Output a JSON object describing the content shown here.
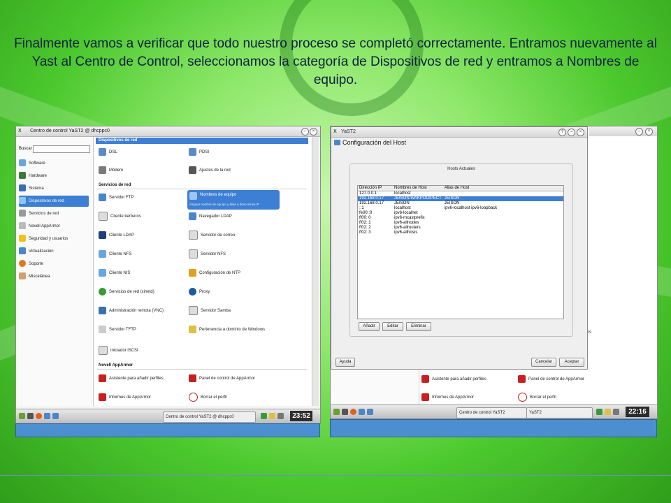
{
  "caption": "Finalmente vamos a verificar que todo nuestro proceso se completó correctamente. Entramos nuevamente al Yast al Centro de Control, seleccionamos la categoría de Dispositivos de red y entramos a Nombres de equipo.",
  "left": {
    "title": "Centro de control YaST2 @ dhcppc0",
    "search_label": "Buscar",
    "sidebar": [
      "Software",
      "Hardware",
      "Sistema",
      "Dispositivos de red",
      "Servicios de red",
      "Novell AppArmor",
      "Seguridad y usuarios",
      "Virtualización",
      "Soporte",
      "Miscelánea"
    ],
    "sections": {
      "devices": "Dispositivos de red",
      "services": "Servicios de red",
      "apparmor": "Novell AppArmor"
    },
    "devices": [
      "DSL",
      "PDSI",
      "Módem",
      "Ajustes de la red"
    ],
    "services": [
      "Servidor FTP",
      "Nombres de equipo",
      "Cliente kerberos",
      "Navegador LDAP",
      "Cliente LDAP",
      "Servidor de correo",
      "Cliente NFS",
      "Servidor NFS",
      "Cliente NIS",
      "Configuración de NTP",
      "Servicios de red (xinetd)",
      "Proxy",
      "Administración remota (VNC)",
      "Servidor Samba",
      "Servidor TFTP",
      "Pertenencia a dominio de Windows",
      "Iniciador iSCSI"
    ],
    "hostnames_tooltip": "Asignar nombre de equipo y alias a direcciones IP",
    "apparmor": [
      "Asistente para añadir perfiles",
      "Panel de control de AppArmor",
      "Informes de AppArmor",
      "Borrar el perfil"
    ],
    "task_label": "Centro de control YaST2 @ dhcppc0",
    "clock": "23:52"
  },
  "right": {
    "title": "YaST2",
    "heading": "Configuración del Host",
    "group_label": "Hosts Actuales",
    "columns": [
      "Dirección IP",
      "Nombres de Host",
      "Alias de Host"
    ],
    "rows": [
      [
        "127.0.0.1",
        "localhost",
        ""
      ],
      [
        "192.168.0.17",
        "JEISON.WAKPOOIPECT",
        "JEISON"
      ],
      [
        "192.168.0.17",
        "JEISON",
        "JEISON"
      ],
      [
        "::1",
        "localhost",
        "ipv6-localhost ipv6-loopback"
      ],
      [
        "fe00::0",
        "ipv6-localnet",
        ""
      ],
      [
        "ff00::0",
        "ipv6-mcastprefix",
        ""
      ],
      [
        "ff02::1",
        "ipv6-allnodes",
        ""
      ],
      [
        "ff02::2",
        "ipv6-allrouters",
        ""
      ],
      [
        "ff02::3",
        "ipv6-allhosts",
        ""
      ]
    ],
    "buttons": {
      "add": "Añadir",
      "edit": "Editar",
      "delete": "Eliminar",
      "help": "Ayuda",
      "cancel": "Cancelar",
      "accept": "Aceptar"
    },
    "bg_items": [
      "Asistente para añadir perfiles",
      "Panel de control de AppArmor",
      "Informes de AppArmor",
      "Borrar el perfil"
    ],
    "bg_fragment": "rs",
    "task1": "Centro de control YaST2",
    "task2": "YaST2",
    "clock": "22:16"
  }
}
